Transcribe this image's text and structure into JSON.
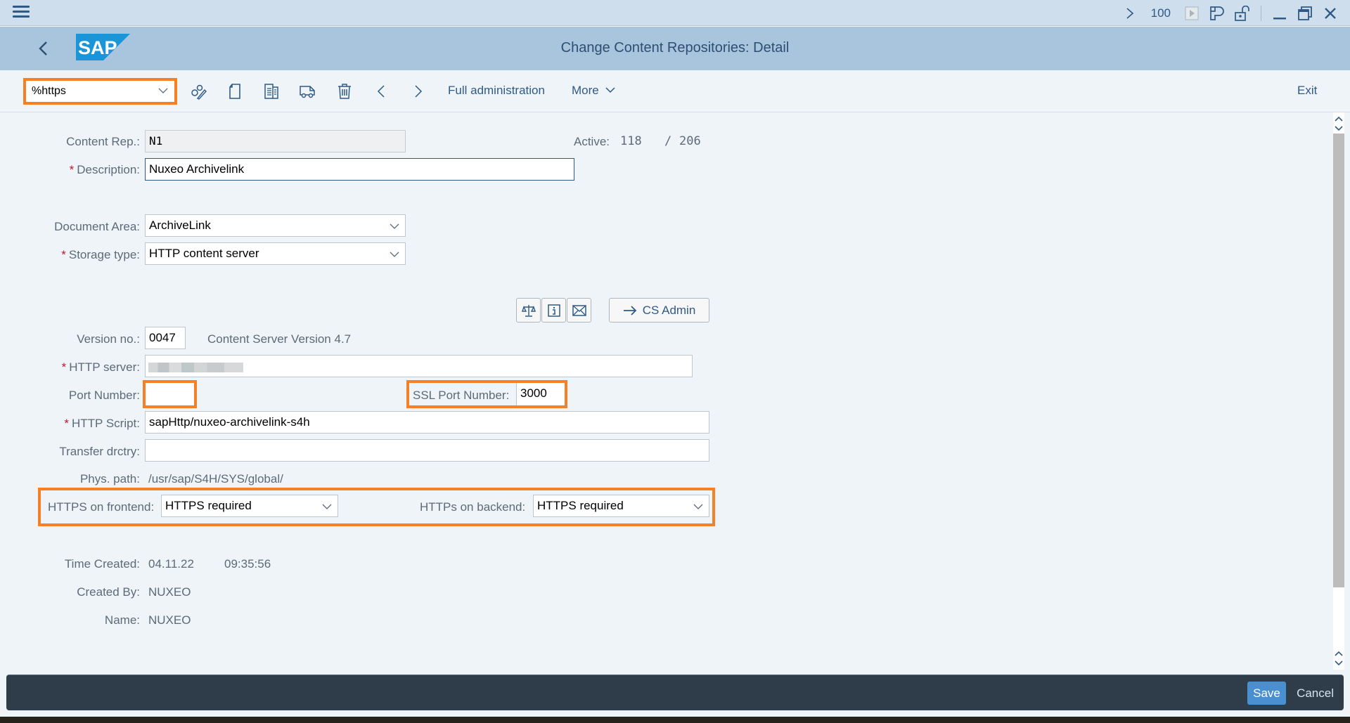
{
  "system_bar": {
    "menu_icon": "hamburger-menu-icon",
    "expand_icon": "chevron-right-icon",
    "client_number": "100",
    "icons": [
      "play-box-icon",
      "layout-icon",
      "unlock-icon",
      "minimize-icon",
      "restore-icon",
      "close-icon"
    ]
  },
  "shell": {
    "back_icon": "chevron-left-icon",
    "logo_text": "SAP",
    "title": "Change Content Repositories: Detail"
  },
  "toolbar": {
    "command_field_value": "%https",
    "icons": [
      "display-change-icon",
      "create-document-icon",
      "copy-document-icon",
      "transport-icon",
      "delete-icon",
      "previous-icon",
      "next-icon"
    ],
    "full_admin_label": "Full administration",
    "more_label": "More",
    "exit_label": "Exit"
  },
  "form": {
    "content_rep": {
      "label": "Content Rep.:",
      "value": "N1"
    },
    "active": {
      "label": "Active:",
      "current": "118",
      "separator": "/",
      "total": "206"
    },
    "description": {
      "label": "Description:",
      "required": "*",
      "value": "Nuxeo Archivelink"
    },
    "document_area": {
      "label": "Document Area:",
      "value": "ArchiveLink"
    },
    "storage_type": {
      "label": "Storage type:",
      "required": "*",
      "value": "HTTP content server"
    },
    "buttons": {
      "icon_buttons": [
        "scales-icon",
        "info-icon",
        "envelope-icon"
      ],
      "cs_admin_label": "CS Admin",
      "cs_admin_icon": "arrow-right-icon"
    },
    "version_no": {
      "label": "Version no.:",
      "value": "0047",
      "description": "Content Server Version 4.7"
    },
    "http_server": {
      "label": "HTTP server:",
      "required": "*",
      "value": ""
    },
    "port_number": {
      "label": "Port Number:",
      "value": ""
    },
    "ssl_port_number": {
      "label": "SSL Port Number:",
      "value": "3000"
    },
    "http_script": {
      "label": "HTTP Script:",
      "required": "*",
      "value": "sapHttp/nuxeo-archivelink-s4h"
    },
    "transfer_directory": {
      "label": "Transfer drctry:",
      "value": ""
    },
    "phys_path": {
      "label": "Phys. path:",
      "value": "/usr/sap/S4H/SYS/global/"
    },
    "https_frontend": {
      "label": "HTTPS on frontend:",
      "value": "HTTPS required"
    },
    "https_backend": {
      "label": "HTTPs on backend:",
      "value": "HTTPS required"
    },
    "time_created": {
      "label": "Time Created:",
      "date": "04.11.22",
      "time": "09:35:56"
    },
    "created_by": {
      "label": "Created By:",
      "value": "NUXEO"
    },
    "name": {
      "label": "Name:",
      "value": "NUXEO"
    }
  },
  "footer": {
    "save_label": "Save",
    "cancel_label": "Cancel"
  },
  "colors": {
    "highlight": "#f58025",
    "primary_text": "#2f5a86",
    "shell_bg": "#a9c4dd",
    "footer_bg": "#2f3c4a",
    "save_bg": "#4a8fcf",
    "required": "#c4142b"
  }
}
